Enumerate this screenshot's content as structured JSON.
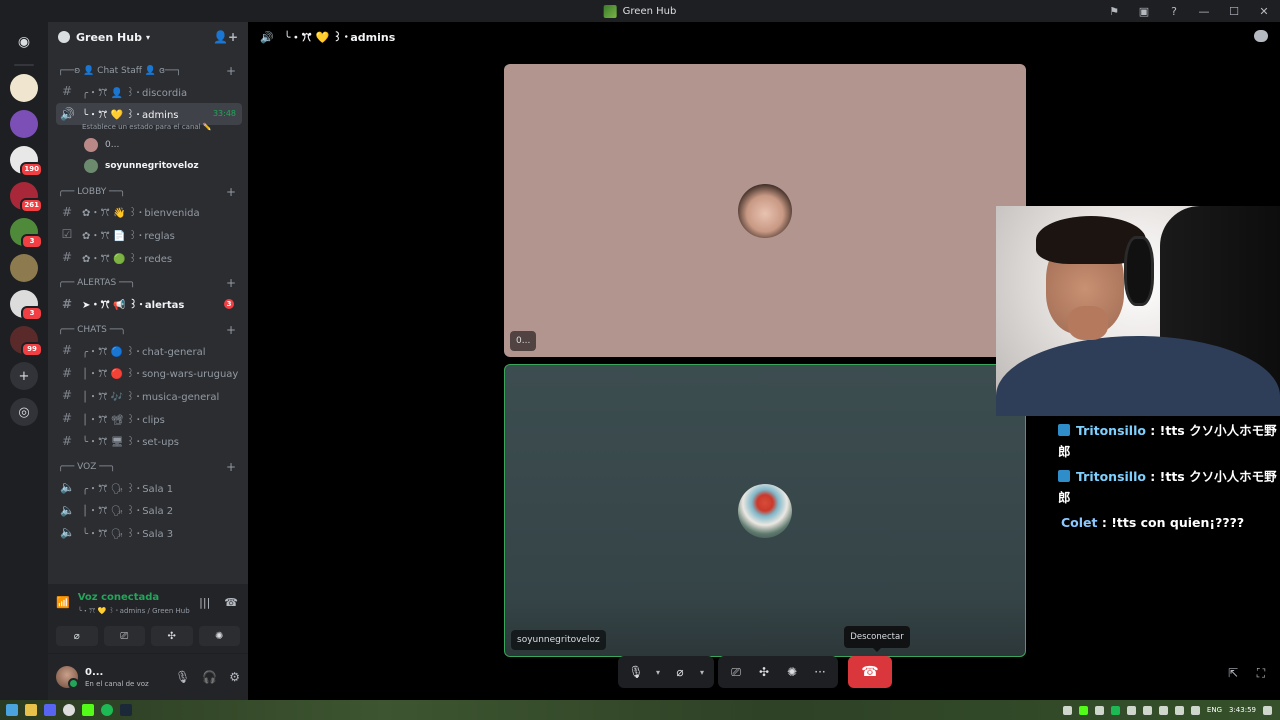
{
  "window": {
    "title": "Green Hub"
  },
  "rail": {
    "servers": [
      {
        "name": "discord-home",
        "color": "#1e1f22",
        "badge": ""
      },
      {
        "name": "server-orange",
        "color": "#f0e6cf",
        "badge": ""
      },
      {
        "name": "server-purple",
        "color": "#7b4fb5",
        "badge": ""
      },
      {
        "name": "server-logo",
        "color": "#e8e8e8",
        "badge": "190"
      },
      {
        "name": "server-red",
        "color": "#a8283a",
        "badge": "261"
      },
      {
        "name": "server-green-hub",
        "color": "#4e8a3a",
        "badge": "3"
      },
      {
        "name": "server-photo",
        "color": "#8d7a4e",
        "badge": ""
      },
      {
        "name": "server-face",
        "color": "#dcdcdc",
        "badge": "3"
      },
      {
        "name": "server-dark",
        "color": "#5a2a2a",
        "badge": "99"
      }
    ]
  },
  "sidebar": {
    "server_name": "Green Hub",
    "categories": [
      {
        "label": "┌──ʚ 👤 Chat Staff 👤 ɞ──┐",
        "channels": [
          {
            "icon": "#",
            "label": "╭・ꔫ 👤 ꒱・discordia",
            "state": "normal"
          },
          {
            "icon": "🔊",
            "label": "╰・ꔫ 💛 ꒱・admins",
            "state": "active",
            "time": "33:48",
            "status": "Establece un estado para el canal ✏️"
          }
        ],
        "voice_users": [
          {
            "name": "0...",
            "bold": false,
            "avatar": "#b88"
          },
          {
            "name": "soyunnegritoveloz",
            "bold": true,
            "avatar": "#6b8a6e"
          }
        ]
      },
      {
        "label": "╭── LOBBY ──╮",
        "channels": [
          {
            "icon": "#",
            "label": "✿・ꔫ 👋 ꒱・bienvenida",
            "state": "normal"
          },
          {
            "icon": "☑",
            "label": "✿・ꔫ 📄 ꒱・reglas",
            "state": "normal"
          },
          {
            "icon": "#",
            "label": "✿・ꔫ 🟢 ꒱・redes",
            "state": "normal"
          }
        ]
      },
      {
        "label": "╭── ALERTAS ──╮",
        "channels": [
          {
            "icon": "#",
            "label": "➤・ꔫ 📢 ꒱・alertas",
            "state": "unread",
            "mention": "3"
          }
        ]
      },
      {
        "label": "╭── CHATS ──╮",
        "channels": [
          {
            "icon": "#",
            "label": "╭・ꔫ 🔵 ꒱・chat-general",
            "state": "normal"
          },
          {
            "icon": "#",
            "label": "│・ꔫ 🔴 ꒱・song-wars-uruguay",
            "state": "normal"
          },
          {
            "icon": "#",
            "label": "│・ꔫ 🎶 ꒱・musica-general",
            "state": "normal"
          },
          {
            "icon": "#",
            "label": "│・ꔫ 📽 ꒱・clips",
            "state": "normal"
          },
          {
            "icon": "#",
            "label": "╰・ꔫ 🖥 ꒱・set-ups",
            "state": "normal"
          }
        ]
      },
      {
        "label": "╭── VOZ ──╮",
        "channels": [
          {
            "icon": "🔈",
            "label": "╭・ꔫ 🗣 ꒱・Sala 1",
            "state": "normal"
          },
          {
            "icon": "🔈",
            "label": "│・ꔫ 🗣 ꒱・Sala 2",
            "state": "normal"
          },
          {
            "icon": "🔈",
            "label": "╰・ꔫ 🗣 ꒱・Sala 3",
            "state": "normal"
          }
        ]
      }
    ]
  },
  "voice_panel": {
    "title": "Voz conectada",
    "subtitle": "╰・ꔫ 💛 ꒱・admins / Green Hub"
  },
  "user_panel": {
    "name": "0...",
    "status": "En el canal de voz"
  },
  "main": {
    "channel_title": "╰・ꔫ 💛 ꒱・admins",
    "tiles": [
      {
        "label": "0..."
      },
      {
        "label": "soyunnegritoveloz"
      }
    ],
    "tooltip": "Desconectar"
  },
  "tts_chat": [
    {
      "user": "Tritonsillo",
      "text": " : !tts クソ小人ホモ野郎",
      "badge": true
    },
    {
      "user": "Tritonsillo",
      "text": " : !tts クソ小人ホモ野郎",
      "badge": true
    },
    {
      "user": "Colet",
      "text": " : !tts con quien¡????",
      "badge": false
    }
  ],
  "taskbar": {
    "lang": "ENG",
    "time": "3:43:59"
  }
}
